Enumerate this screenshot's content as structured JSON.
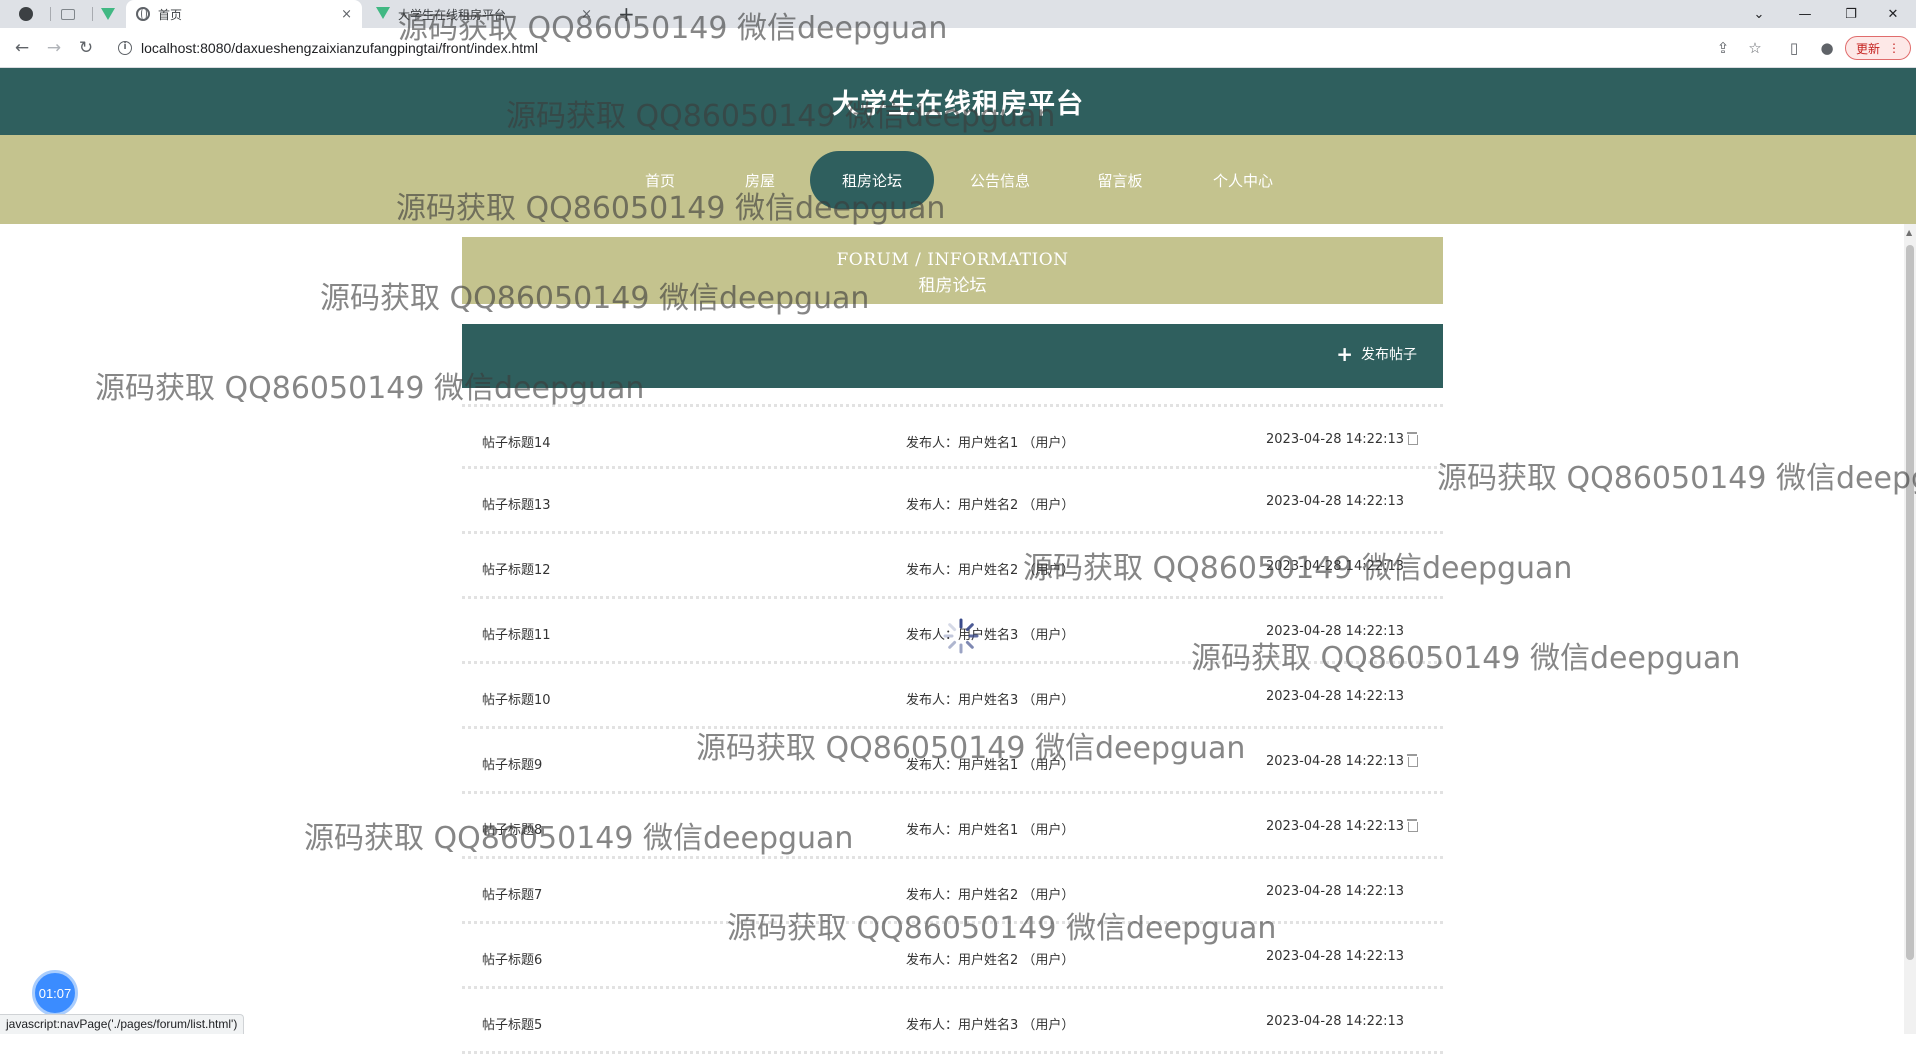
{
  "browser": {
    "tabs": [
      {
        "label": "首页",
        "favicon": "globe-icon",
        "active": true
      },
      {
        "label": "大学生在线租房平台",
        "favicon": "vue-logo-icon",
        "active": false
      }
    ],
    "close_glyph": "×",
    "new_tab_glyph": "+",
    "url": "localhost:8080/daxueshengzaixianzufangpingtai/front/index.html",
    "update_label": "更新",
    "update_menu_glyph": "⋮"
  },
  "site": {
    "title": "大学生在线租房平台",
    "nav": [
      {
        "label": "首页",
        "active": false
      },
      {
        "label": "房屋",
        "active": false
      },
      {
        "label": "租房论坛",
        "active": true
      },
      {
        "label": "公告信息",
        "active": false
      },
      {
        "label": "留言板",
        "active": false
      },
      {
        "label": "个人中心",
        "active": false
      }
    ]
  },
  "section": {
    "title_en": "FORUM / INFORMATION",
    "title_cn": "租房论坛"
  },
  "actions": {
    "post_label": "发布帖子",
    "post_icon": "plus-icon"
  },
  "posts": [
    {
      "title": "帖子标题14",
      "author": "发布人：用户姓名1 （用户）",
      "time": "2023-04-28 14:22:13",
      "deletable": true
    },
    {
      "title": "帖子标题13",
      "author": "发布人：用户姓名2 （用户）",
      "time": "2023-04-28 14:22:13",
      "deletable": false
    },
    {
      "title": "帖子标题12",
      "author": "发布人：用户姓名2 （用户）",
      "time": "2023-04-28 14:22:13",
      "deletable": false
    },
    {
      "title": "帖子标题11",
      "author": "发布人：用户姓名3 （用户）",
      "time": "2023-04-28 14:22:13",
      "deletable": false
    },
    {
      "title": "帖子标题10",
      "author": "发布人：用户姓名3 （用户）",
      "time": "2023-04-28 14:22:13",
      "deletable": false
    },
    {
      "title": "帖子标题9",
      "author": "发布人：用户姓名1 （用户）",
      "time": "2023-04-28 14:22:13",
      "deletable": true
    },
    {
      "title": "帖子标题8",
      "author": "发布人：用户姓名1 （用户）",
      "time": "2023-04-28 14:22:13",
      "deletable": true
    },
    {
      "title": "帖子标题7",
      "author": "发布人：用户姓名2 （用户）",
      "time": "2023-04-28 14:22:13",
      "deletable": false
    },
    {
      "title": "帖子标题6",
      "author": "发布人：用户姓名2 （用户）",
      "time": "2023-04-28 14:22:13",
      "deletable": false
    },
    {
      "title": "帖子标题5",
      "author": "发布人：用户姓名3 （用户）",
      "time": "2023-04-28 14:22:13",
      "deletable": false
    }
  ],
  "overlay": {
    "timer": "01:07",
    "status_link": "javascript:navPage('./pages/forum/list.html')",
    "watermark": "源码获取 QQ86050149 微信deepguan"
  },
  "colors": {
    "primary": "#2f5f5e",
    "accent": "#c4c38e"
  }
}
